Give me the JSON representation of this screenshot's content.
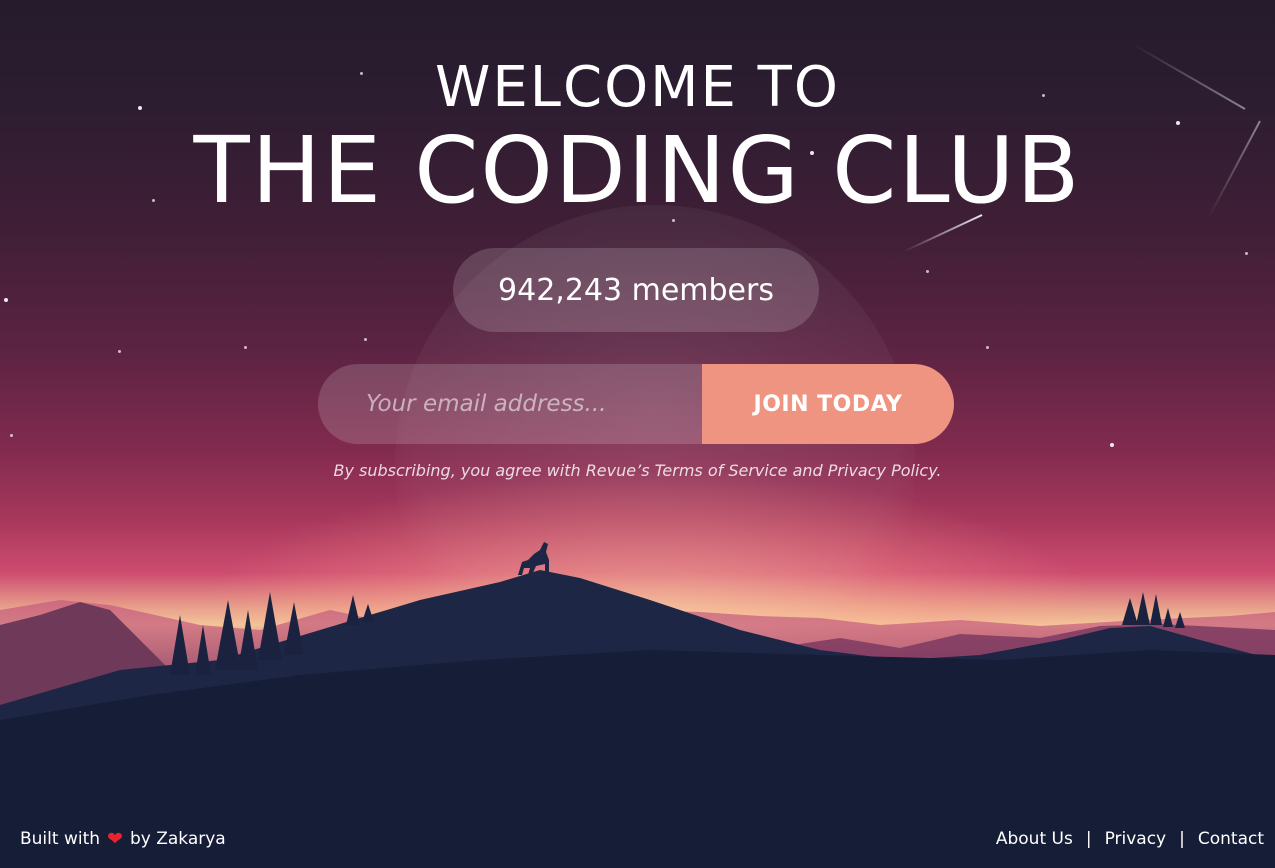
{
  "hero": {
    "title_small": "WELCOME TO",
    "title_big": "THE CODING CLUB",
    "members_text": "942,243 members"
  },
  "signup": {
    "email_placeholder": "Your email address...",
    "join_label": "JOIN TODAY",
    "terms_prefix": "By subscribing, you agree with Revue’s ",
    "terms_link": "Terms of Service",
    "terms_middle": " and ",
    "privacy_link": "Privacy Policy",
    "terms_suffix": "."
  },
  "footer": {
    "built_prefix": "Built with",
    "built_suffix": "by Zakarya",
    "heart_glyph": "❤",
    "links": {
      "about": "About Us",
      "privacy": "Privacy",
      "contact": "Contact"
    },
    "separator": "|"
  },
  "colors": {
    "accent_button": "#ef9480",
    "heart": "#e8232f",
    "hill_dark": "#141b31"
  },
  "icons": {
    "heart": "heart-icon"
  }
}
